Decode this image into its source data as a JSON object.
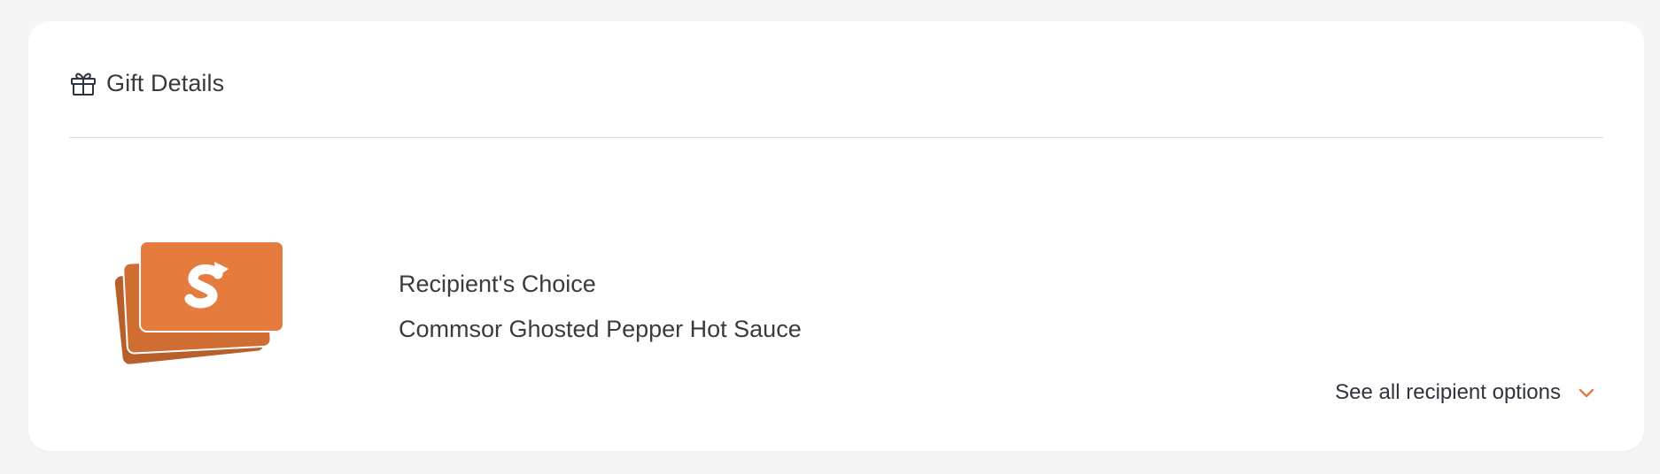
{
  "card": {
    "title": "Gift Details",
    "title_icon": "gift-icon"
  },
  "gift": {
    "image_icon": "gift-cards-stack-icon",
    "brand_color": "#e57b3d",
    "lines": [
      "Recipient's Choice",
      "Commsor Ghosted Pepper Hot Sauce"
    ]
  },
  "options": {
    "see_all_label": "See all recipient options",
    "icon": "chevron-down-icon",
    "accent_color": "#e57b3d"
  }
}
